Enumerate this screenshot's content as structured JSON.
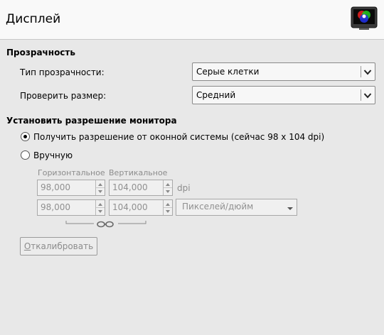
{
  "header": {
    "title": "Дисплей",
    "icon": "monitor-color-icon"
  },
  "transparency": {
    "section_title": "Прозрачность",
    "type_label": "Тип прозрачности:",
    "type_value": "Серые клетки",
    "size_label": "Проверить размер:",
    "size_value": "Средний"
  },
  "resolution": {
    "section_title": "Установить разрешение монитора",
    "option_system_label": "Получить разрешение от оконной системы (сейчас 98 x 104 dpi)",
    "option_system_selected": true,
    "option_manual_label": "Вручную",
    "option_manual_selected": false,
    "horizontal_label": "Горизонтальное",
    "vertical_label": "Вертикальное",
    "row1_h": "98,000",
    "row1_v": "104,000",
    "row1_unit": "dpi",
    "row2_h": "98,000",
    "row2_v": "104,000",
    "row2_unit": "Пикселей/дюйм",
    "chain_icon": "chain-link-icon",
    "calibrate_label": "Откалибровать",
    "calibrate_mnemonic": "О"
  },
  "colors": {
    "header_bg": "#f9f9f9",
    "body_bg": "#e8e8e8",
    "disabled_text": "#8c8c8c"
  }
}
